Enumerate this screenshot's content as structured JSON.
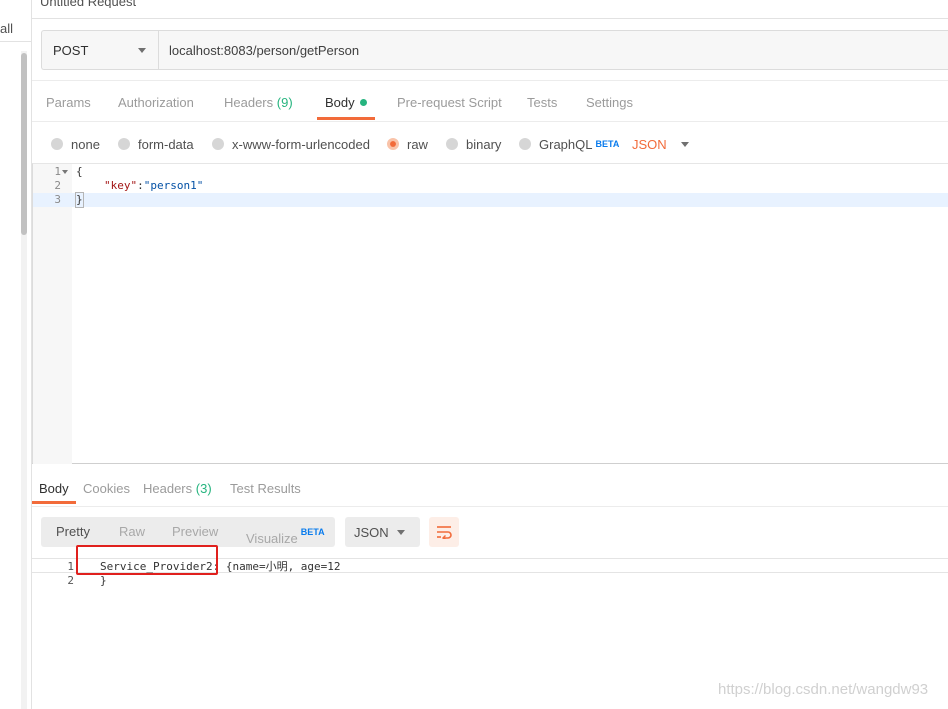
{
  "sidebar": {
    "partial_text": "all"
  },
  "request": {
    "tab_title": "Untitled Request",
    "method": "POST",
    "url": "localhost:8083/person/getPerson"
  },
  "request_tabs": [
    {
      "label": "Params",
      "active": false
    },
    {
      "label": "Authorization",
      "active": false
    },
    {
      "label": "Headers",
      "count": "(9)",
      "active": false
    },
    {
      "label": "Body",
      "active": true
    },
    {
      "label": "Pre-request Script",
      "active": false
    },
    {
      "label": "Tests",
      "active": false
    },
    {
      "label": "Settings",
      "active": false
    }
  ],
  "body_types": {
    "options": [
      "none",
      "form-data",
      "x-www-form-urlencoded",
      "raw",
      "binary",
      "GraphQL"
    ],
    "selected": "raw",
    "graphql_badge": "BETA",
    "language": "JSON"
  },
  "editor": {
    "lines": [
      {
        "num": "1",
        "text": "{"
      },
      {
        "num": "2",
        "key": "\"key\"",
        "sep": ":",
        "value": "\"person1\""
      },
      {
        "num": "3",
        "text": "}"
      }
    ]
  },
  "response_tabs": [
    {
      "label": "Body",
      "active": true
    },
    {
      "label": "Cookies",
      "active": false
    },
    {
      "label": "Headers",
      "count": "(3)",
      "active": false
    },
    {
      "label": "Test Results",
      "active": false
    }
  ],
  "response_view": {
    "modes": [
      "Pretty",
      "Raw",
      "Preview",
      "Visualize"
    ],
    "active_mode": "Pretty",
    "visualize_badge": "BETA",
    "format": "JSON",
    "wrap_icon": "wrap-lines-icon"
  },
  "response_body": {
    "lines": [
      {
        "num": "1",
        "text": "Service_Provider2: {name=小明, age=12"
      },
      {
        "num": "2",
        "text": "}"
      }
    ]
  },
  "watermark": "https://blog.csdn.net/wangdw93",
  "colors": {
    "accent": "#f26b3a",
    "green": "#26b47f",
    "beta": "#097bed",
    "highlight_box": "#e0201d"
  }
}
